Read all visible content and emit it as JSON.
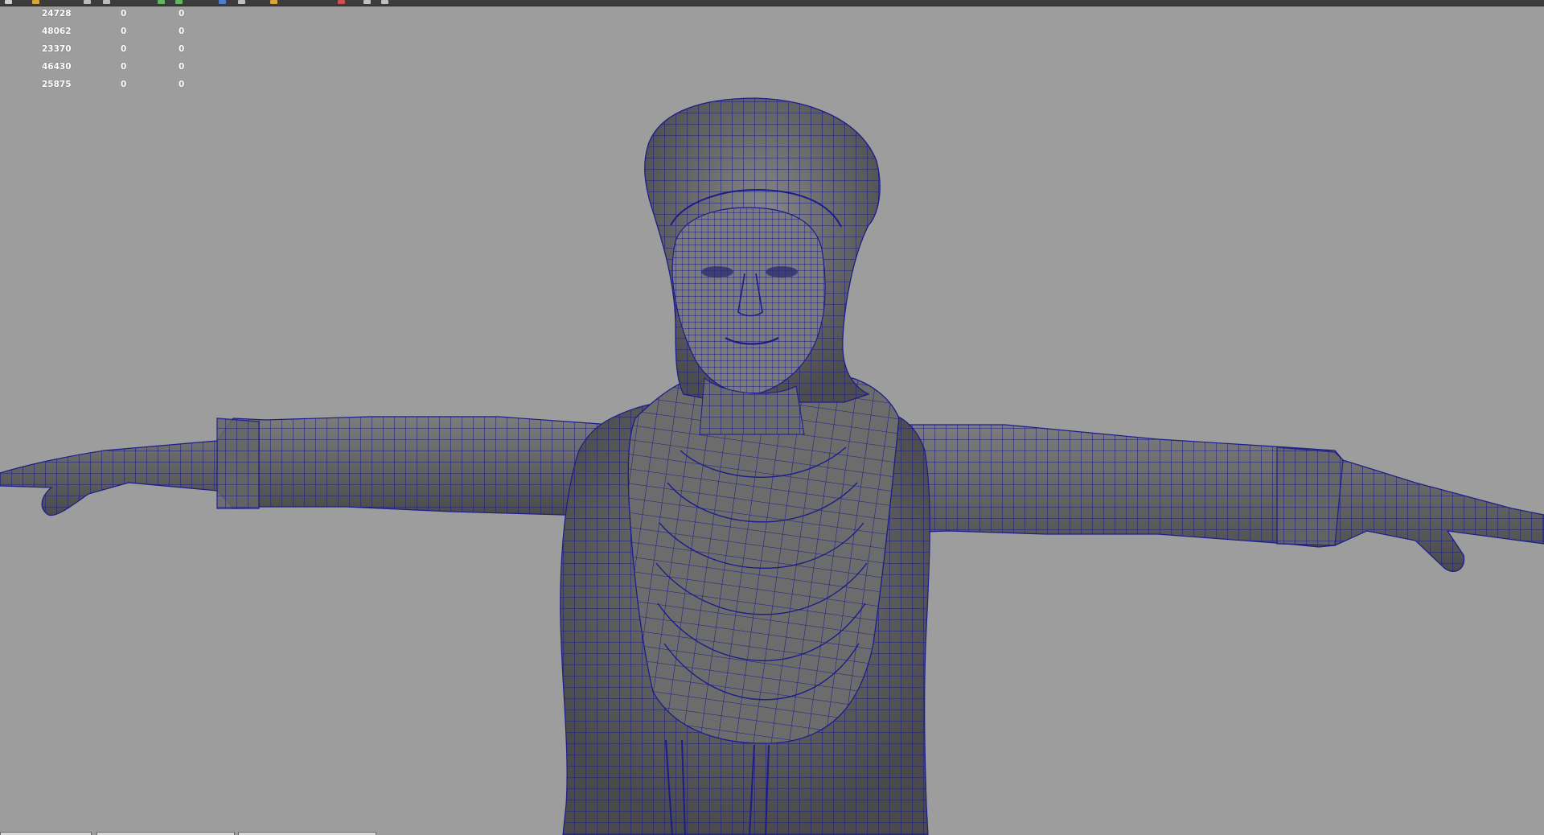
{
  "viewport": {
    "background": "#9d9d9d",
    "wire_color": "#1a1a8c",
    "mesh_shade": "#5e5e5e"
  },
  "hud": {
    "rows": [
      {
        "c0": "24728",
        "c1": "0",
        "c2": "0"
      },
      {
        "c0": "48062",
        "c1": "0",
        "c2": "0"
      },
      {
        "c0": "23370",
        "c1": "0",
        "c2": "0"
      },
      {
        "c0": "46430",
        "c1": "0",
        "c2": "0"
      },
      {
        "c0": "25875",
        "c1": "0",
        "c2": "0"
      }
    ]
  },
  "toolbar": {
    "icons": [
      "grid-icon",
      "wireframe-icon",
      "shaded-icon",
      "texture-icon",
      "light-icon",
      "camera-icon",
      "isolate-icon",
      "xray-icon"
    ]
  }
}
